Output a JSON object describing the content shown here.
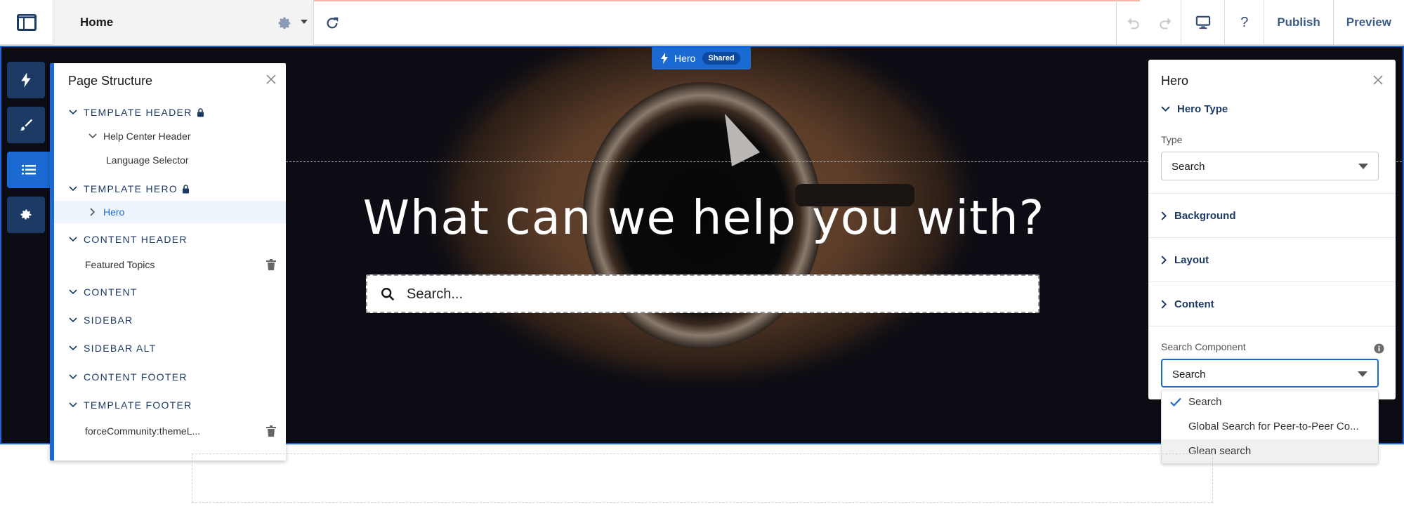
{
  "topbar": {
    "page_name": "Home",
    "publish": "Publish",
    "preview": "Preview",
    "help": "?"
  },
  "hero_chip": {
    "label": "Hero",
    "badge": "Shared"
  },
  "canvas": {
    "headline": "What can we help you with?",
    "search_placeholder": "Search..."
  },
  "structure": {
    "title": "Page Structure",
    "items": [
      {
        "label": "TEMPLATE HEADER",
        "kind": "section",
        "locked": true
      },
      {
        "label": "Help Center Header",
        "kind": "child"
      },
      {
        "label": "Language Selector",
        "kind": "child"
      },
      {
        "label": "TEMPLATE HERO",
        "kind": "section",
        "locked": true
      },
      {
        "label": "Hero",
        "kind": "child"
      },
      {
        "label": "CONTENT HEADER",
        "kind": "section"
      },
      {
        "label": "Featured Topics",
        "kind": "child"
      },
      {
        "label": "CONTENT",
        "kind": "section"
      },
      {
        "label": "SIDEBAR",
        "kind": "section"
      },
      {
        "label": "SIDEBAR ALT",
        "kind": "section"
      },
      {
        "label": "CONTENT FOOTER",
        "kind": "section"
      },
      {
        "label": "TEMPLATE FOOTER",
        "kind": "section"
      },
      {
        "label": "forceCommunity:themeL...",
        "kind": "child"
      }
    ]
  },
  "props": {
    "title": "Hero",
    "hero_type_section": "Hero Type",
    "type_label": "Type",
    "type_value": "Search",
    "sections": [
      "Background",
      "Layout",
      "Content"
    ],
    "search_component_label": "Search Component",
    "search_component_value": "Search",
    "options": [
      "Search",
      "Global Search for Peer-to-Peer Co...",
      "Glean search"
    ]
  },
  "colors": {
    "accent": "#1b6ad3",
    "rail": "#1d3a64"
  }
}
